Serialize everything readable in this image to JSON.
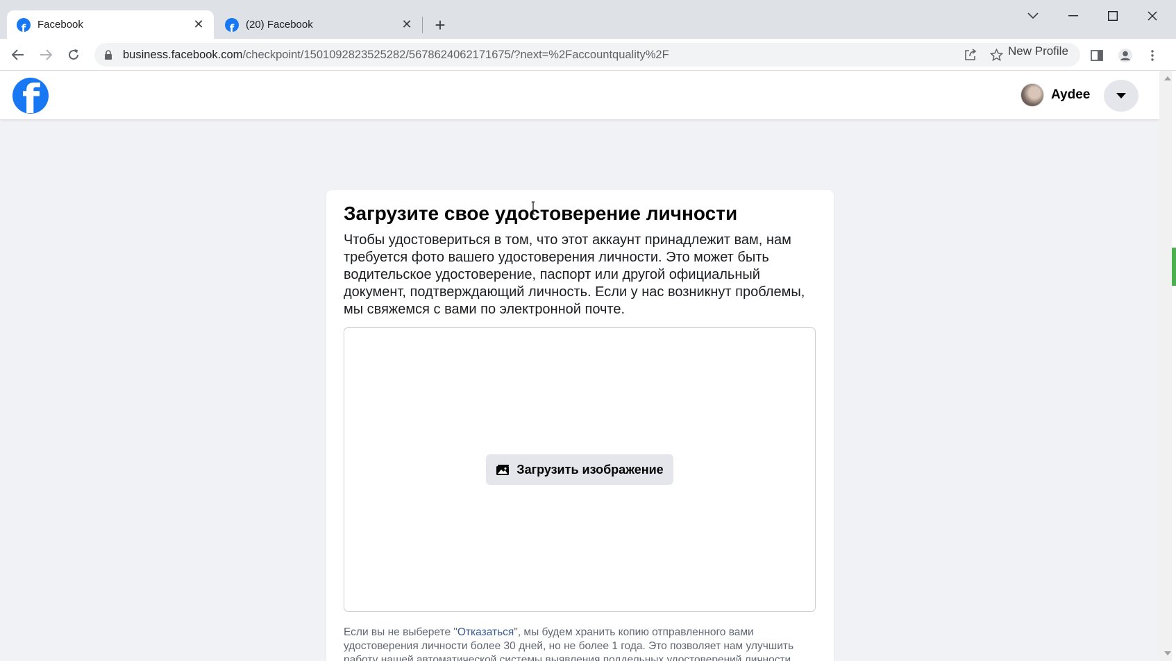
{
  "browser": {
    "tabs": [
      {
        "title": "Facebook",
        "active": true
      },
      {
        "title": "(20) Facebook",
        "active": false
      }
    ],
    "url_host": "business.facebook.com",
    "url_path": "/checkpoint/1501092823525282/5678624062171675/?next=%2Faccountquality%2F",
    "profile_label": "New Profile"
  },
  "header": {
    "user_name": "Aydee"
  },
  "card": {
    "title": "Загрузите свое удостоверение личности",
    "description": "Чтобы удостовериться в том, что этот аккаунт принадлежит вам, нам требуется фото вашего удостоверения личности. Это может быть водительское удостоверение, паспорт или другой официальный документ, подтверждающий личность. Если у нас возникнут проблемы, мы свяжемся с вами по электронной почте.",
    "upload_button": "Загрузить изображение",
    "fineprint_before": "Если вы не выберете \"",
    "fineprint_link": "Отказаться",
    "fineprint_after": "\", мы будем хранить копию отправленного вами удостоверения личности более 30 дней, но не более 1 года. Это позволяет нам улучшить работу нашей автоматической системы выявления поддельных удостоверений личности."
  },
  "colors": {
    "brand": "#1877f2",
    "link": "#385898"
  }
}
